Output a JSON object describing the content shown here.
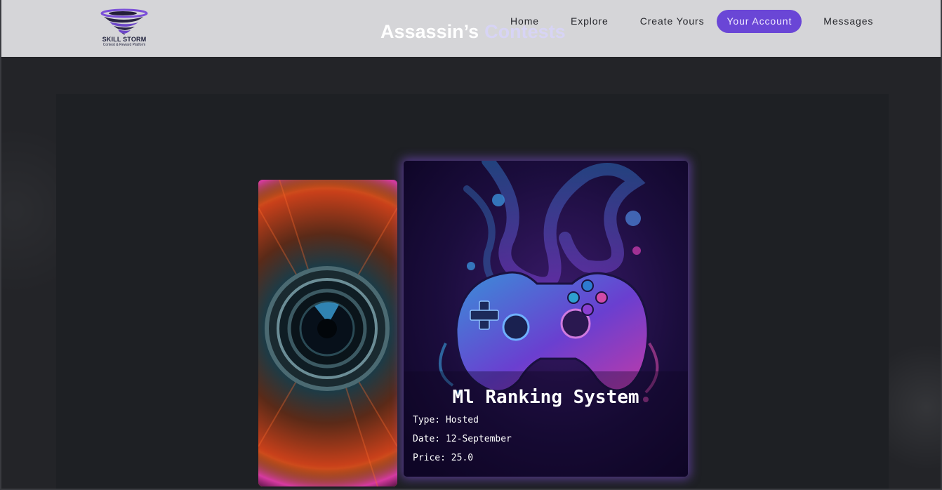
{
  "header": {
    "logo": {
      "title": "SKILL STORM",
      "subtitle": "Contest & Reward Platform",
      "icon": "tornado-logo-icon"
    },
    "page_title_part1": "Assassin’s",
    "page_title_part2": "Contests",
    "nav": {
      "home": "Home",
      "explore": "Explore",
      "create": "Create Yours",
      "account": "Your Account",
      "messages": "Messages"
    },
    "active_nav": "account"
  },
  "cards": {
    "previous": {
      "image": "camera-lens-eye-image"
    },
    "featured": {
      "image": "game-controller-art-image",
      "title": "Ml Ranking System",
      "type": "Type: Hosted",
      "date": "Date: 12-September",
      "price": "Price: 25.0"
    }
  },
  "colors": {
    "accent": "#6a46d6",
    "header_bg": "#d5d5d8",
    "page_bg": "#232428",
    "card_glow": "#7c4cd6"
  }
}
